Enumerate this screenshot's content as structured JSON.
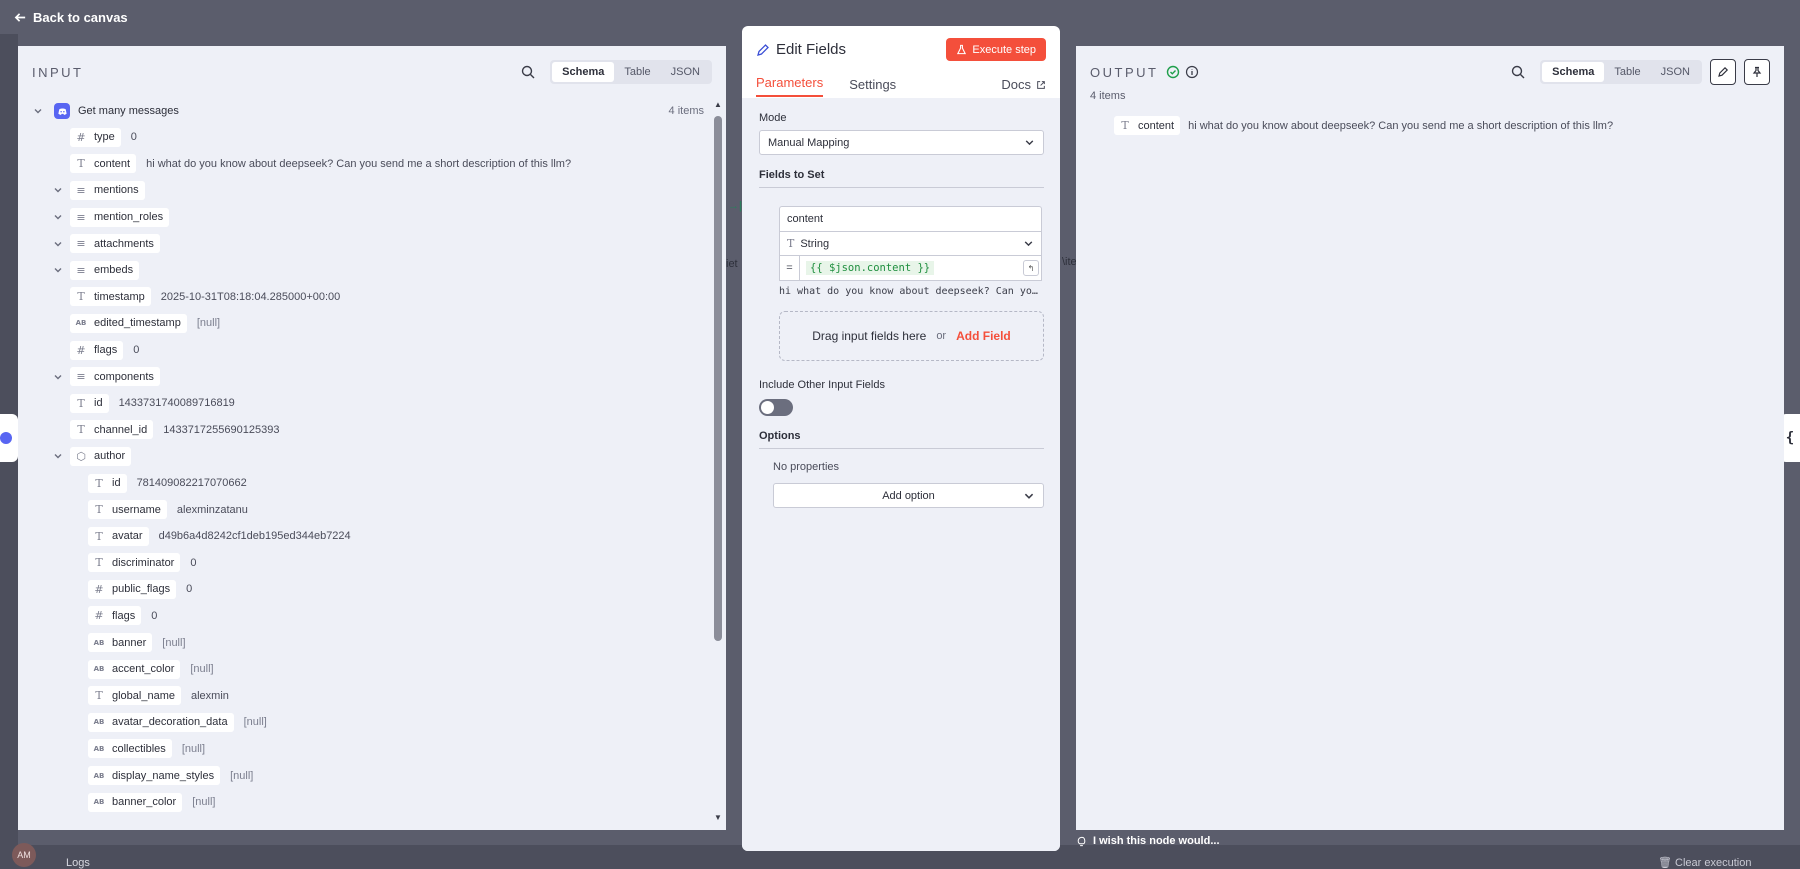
{
  "topbar": {
    "back_label": "Back to canvas"
  },
  "input": {
    "title": "INPUT",
    "view_modes": [
      "Schema",
      "Table",
      "JSON"
    ],
    "active_view": "Schema",
    "root_label": "Get many messages",
    "items_count": "4 items",
    "rows": [
      {
        "name": "type",
        "type": "number",
        "value": "0",
        "depth": 1,
        "chev": false
      },
      {
        "name": "content",
        "type": "string",
        "value": "hi what do you know about deepseek? Can you send me a short description of this llm?",
        "depth": 1,
        "chev": false
      },
      {
        "name": "mentions",
        "type": "array",
        "value": "",
        "depth": 1,
        "chev": true
      },
      {
        "name": "mention_roles",
        "type": "array",
        "value": "",
        "depth": 1,
        "chev": true
      },
      {
        "name": "attachments",
        "type": "array",
        "value": "",
        "depth": 1,
        "chev": true
      },
      {
        "name": "embeds",
        "type": "array",
        "value": "",
        "depth": 1,
        "chev": true
      },
      {
        "name": "timestamp",
        "type": "string",
        "value": "2025-10-31T08:18:04.285000+00:00",
        "depth": 1,
        "chev": false
      },
      {
        "name": "edited_timestamp",
        "type": "null",
        "value": "[null]",
        "depth": 1,
        "chev": false
      },
      {
        "name": "flags",
        "type": "number",
        "value": "0",
        "depth": 1,
        "chev": false
      },
      {
        "name": "components",
        "type": "array",
        "value": "",
        "depth": 1,
        "chev": true
      },
      {
        "name": "id",
        "type": "string",
        "value": "1433731740089716819",
        "depth": 1,
        "chev": false
      },
      {
        "name": "channel_id",
        "type": "string",
        "value": "1433717255690125393",
        "depth": 1,
        "chev": false
      },
      {
        "name": "author",
        "type": "object",
        "value": "",
        "depth": 1,
        "chev": true
      },
      {
        "name": "id",
        "type": "string",
        "value": "781409082217070662",
        "depth": 2,
        "chev": false
      },
      {
        "name": "username",
        "type": "string",
        "value": "alexminzatanu",
        "depth": 2,
        "chev": false
      },
      {
        "name": "avatar",
        "type": "string",
        "value": "d49b6a4d8242cf1deb195ed344eb7224",
        "depth": 2,
        "chev": false
      },
      {
        "name": "discriminator",
        "type": "string",
        "value": "0",
        "depth": 2,
        "chev": false
      },
      {
        "name": "public_flags",
        "type": "number",
        "value": "0",
        "depth": 2,
        "chev": false
      },
      {
        "name": "flags",
        "type": "number",
        "value": "0",
        "depth": 2,
        "chev": false
      },
      {
        "name": "banner",
        "type": "null",
        "value": "[null]",
        "depth": 2,
        "chev": false
      },
      {
        "name": "accent_color",
        "type": "null",
        "value": "[null]",
        "depth": 2,
        "chev": false
      },
      {
        "name": "global_name",
        "type": "string",
        "value": "alexmin",
        "depth": 2,
        "chev": false
      },
      {
        "name": "avatar_decoration_data",
        "type": "null",
        "value": "[null]",
        "depth": 2,
        "chev": false
      },
      {
        "name": "collectibles",
        "type": "null",
        "value": "[null]",
        "depth": 2,
        "chev": false
      },
      {
        "name": "display_name_styles",
        "type": "null",
        "value": "[null]",
        "depth": 2,
        "chev": false
      },
      {
        "name": "banner_color",
        "type": "null",
        "value": "[null]",
        "depth": 2,
        "chev": false
      }
    ]
  },
  "edit": {
    "title": "Edit Fields",
    "execute_label": "Execute step",
    "tabs": [
      "Parameters",
      "Settings"
    ],
    "active_tab": "Parameters",
    "docs_label": "Docs",
    "mode_label": "Mode",
    "mode_value": "Manual Mapping",
    "fields_to_set_label": "Fields to Set",
    "field_name": "content",
    "field_type": "String",
    "field_expression": "{{ $json.content }}",
    "field_preview": "hi what do you know about deepseek? Can you send me a short description of this llm?",
    "drag_label": "Drag input fields here",
    "or_label": "or",
    "add_field_label": "Add Field",
    "include_other_label": "Include Other Input Fields",
    "include_other_on": false,
    "options_label": "Options",
    "no_properties_label": "No properties",
    "add_option_label": "Add option"
  },
  "output": {
    "title": "OUTPUT",
    "view_modes": [
      "Schema",
      "Table",
      "JSON"
    ],
    "active_view": "Schema",
    "items_count": "4 items",
    "rows": [
      {
        "name": "content",
        "type": "string",
        "value": "hi what do you know about deepseek? Can you send me a short description of this llm?"
      }
    ]
  },
  "footer": {
    "wish_label": "I wish this node would...",
    "logs_label": "Logs",
    "clear_execution_label": "Clear execution",
    "avatar_initials": "AM"
  },
  "colors": {
    "accent": "#f44f3b",
    "success": "#1e9e4a",
    "discord": "#5865f2",
    "backdrop": "#5b5d6c",
    "panel_bg": "#eef0f7"
  }
}
